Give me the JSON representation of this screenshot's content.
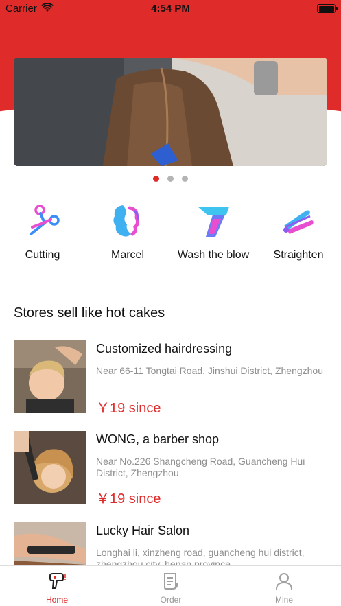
{
  "status_bar": {
    "carrier": "Carrier",
    "time": "4:54 PM"
  },
  "carousel": {
    "page_count": 3,
    "active_index": 0
  },
  "categories": [
    {
      "label": "Cutting",
      "icon": "scissors-comb-icon"
    },
    {
      "label": "Marcel",
      "icon": "curly-hair-icon"
    },
    {
      "label": "Wash the blow",
      "icon": "hair-dryer-icon"
    },
    {
      "label": "Straighten",
      "icon": "hair-straightener-icon"
    }
  ],
  "section": {
    "title": "Stores sell like hot cakes"
  },
  "stores": [
    {
      "name": "Customized hairdressing",
      "address": "Near 66-11 Tongtai Road, Jinshui District, Zhengzhou",
      "price": "￥19 since"
    },
    {
      "name": "WONG, a barber shop",
      "address": "Near No.226 Shangcheng Road, Guancheng Hui District, Zhengzhou",
      "price": "￥19 since"
    },
    {
      "name": "Lucky Hair Salon",
      "address": "Longhai li, xinzheng road, guancheng hui district, zhengzhou city, henan province",
      "price": ""
    }
  ],
  "tabbar": {
    "tabs": [
      {
        "label": "Home",
        "icon": "hair-dryer-icon",
        "active": true
      },
      {
        "label": "Order",
        "icon": "order-list-icon",
        "active": false
      },
      {
        "label": "Mine",
        "icon": "person-icon",
        "active": false
      }
    ]
  },
  "colors": {
    "accent": "#e02b2b",
    "text": "#111111",
    "muted": "#8e8e8e",
    "tab_inactive": "#9a9a9a"
  }
}
